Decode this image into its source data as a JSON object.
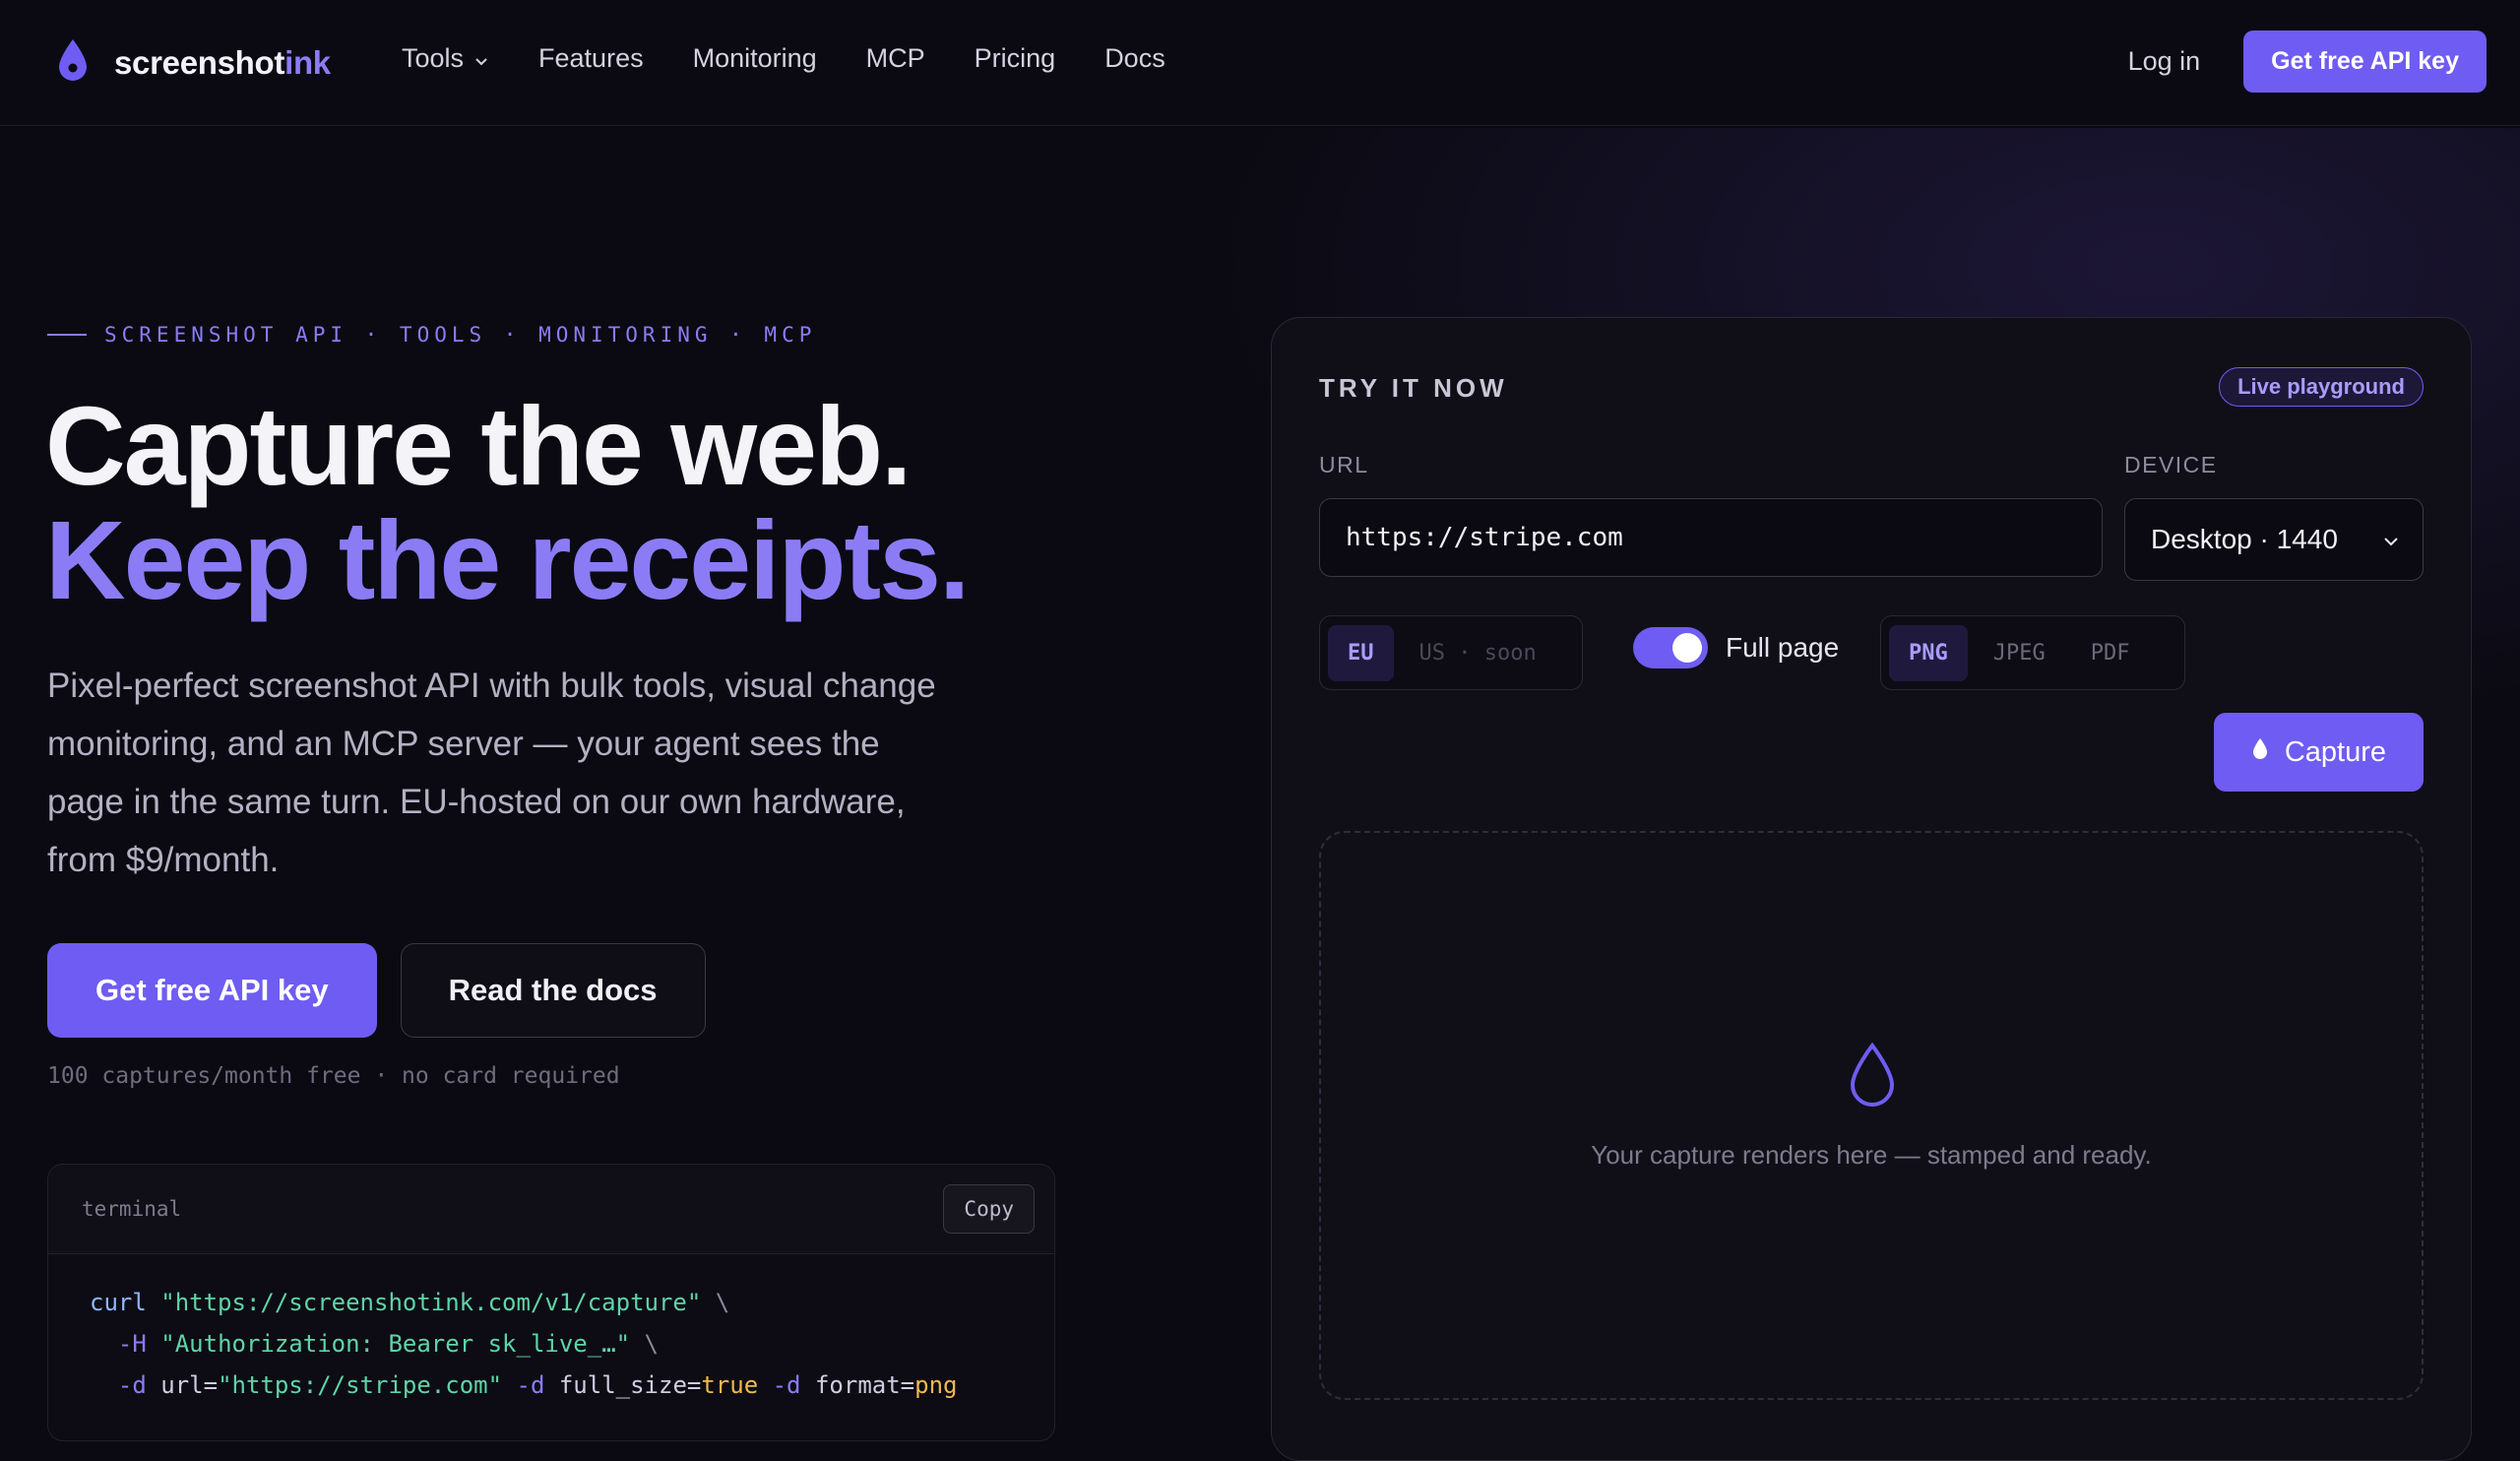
{
  "nav": {
    "brand_prefix": "screenshot",
    "brand_accent": "ink",
    "links": [
      "Tools",
      "Features",
      "Monitoring",
      "MCP",
      "Pricing",
      "Docs"
    ],
    "login": "Log in",
    "cta": "Get free API key"
  },
  "hero": {
    "eyebrow": "SCREENSHOT API · TOOLS · MONITORING · MCP",
    "headline_line1": "Capture the web.",
    "headline_line2": "Keep the receipts.",
    "lede": "Pixel-perfect screenshot API with bulk tools, visual change monitoring, and an MCP server — your agent sees the page in the same turn. EU-hosted on our own hardware, from $9/month.",
    "cta_primary": "Get free API key",
    "cta_secondary": "Read the docs",
    "fineprint": "100 captures/month free · no card required"
  },
  "terminal": {
    "title": "terminal",
    "copy": "Copy",
    "cmd": "curl",
    "url": "\"https://screenshotink.com/v1/capture\"",
    "flag_h": "-H",
    "auth": "\"Authorization: Bearer sk_live_…\"",
    "flag_d": "-d",
    "param_url_key": "url=",
    "param_url_val": "\"https://stripe.com\"",
    "param_full_key": "full_size=",
    "param_full_val": "true",
    "param_fmt_key": "format=",
    "param_fmt_val": "png",
    "continuation": "\\"
  },
  "playground": {
    "title": "TRY IT NOW",
    "badge": "Live playground",
    "url_label": "URL",
    "url_value": "https://stripe.com",
    "device_label": "DEVICE",
    "device_value": "Desktop · 1440",
    "regions": [
      {
        "label": "EU",
        "selected": true
      },
      {
        "label": "US · soon",
        "selected": false
      }
    ],
    "full_page_label": "Full page",
    "full_page_on": true,
    "formats": [
      {
        "label": "PNG",
        "selected": true
      },
      {
        "label": "JPEG",
        "selected": false
      },
      {
        "label": "PDF",
        "selected": false
      }
    ],
    "capture_label": "Capture",
    "placeholder": "Your capture renders here — stamped and ready."
  },
  "colors": {
    "accent": "#6f5cf2",
    "accent_text": "#8b7cf6",
    "background": "#0b0a12"
  },
  "icons": [
    "ink-drop-icon",
    "chevron-down-icon"
  ]
}
